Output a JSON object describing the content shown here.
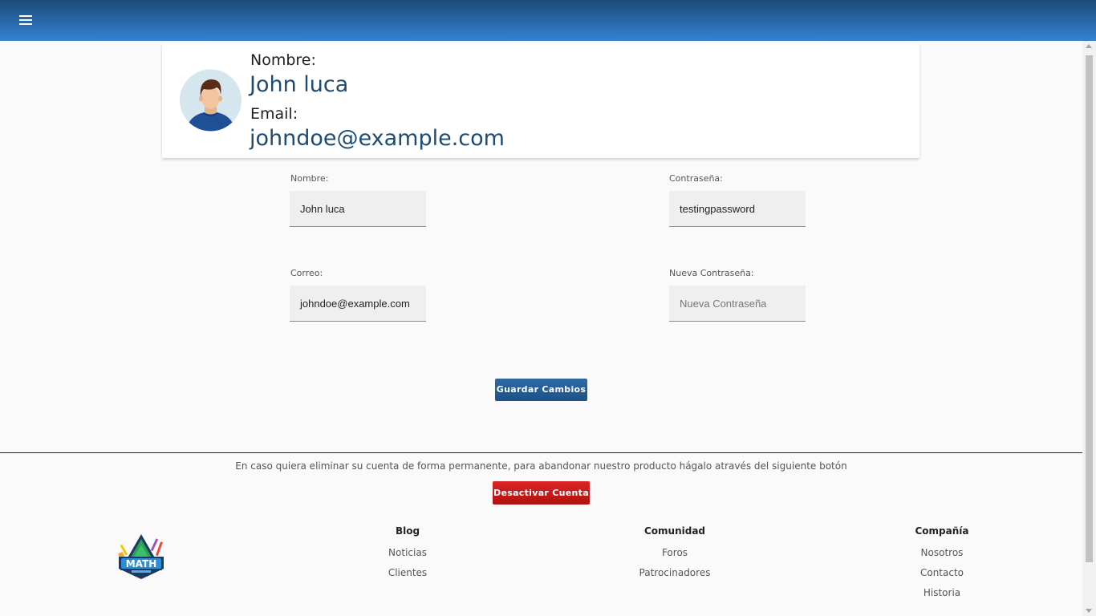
{
  "header": {
    "menu_icon": "hamburger-icon",
    "gradient_top": "#1c4a75",
    "gradient_bottom": "#3582d0"
  },
  "profile": {
    "name_label": "Nombre:",
    "name_value": "John luca",
    "email_label": "Email:",
    "email_value": "johndoe@example.com"
  },
  "form": {
    "name_label": "Nombre:",
    "name_value": "John luca",
    "email_label": "Correo:",
    "email_value": "johndoe@example.com",
    "password_label": "Contraseña:",
    "password_value": "testingpassword",
    "new_password_label": "Nueva Contraseña:",
    "new_password_placeholder": "Nueva Contraseña",
    "save_label": "Guardar Cambios"
  },
  "danger": {
    "note": "En caso quiera eliminar su cuenta de forma permanente, para abandonar nuestro producto hágalo através del siguiente botón",
    "deactivate_label": "Desactivar Cuenta",
    "color": "#c81818"
  },
  "footer": {
    "logo_text": "MATH",
    "columns": [
      {
        "title": "Blog",
        "links": [
          "Noticias",
          "Clientes"
        ]
      },
      {
        "title": "Comunidad",
        "links": [
          "Foros",
          "Patrocinadores"
        ]
      },
      {
        "title": "Compañía",
        "links": [
          "Nosotros",
          "Contacto",
          "Historia"
        ]
      }
    ]
  },
  "colors": {
    "accent": "#1d4b72",
    "button_blue": "#2461a0"
  }
}
